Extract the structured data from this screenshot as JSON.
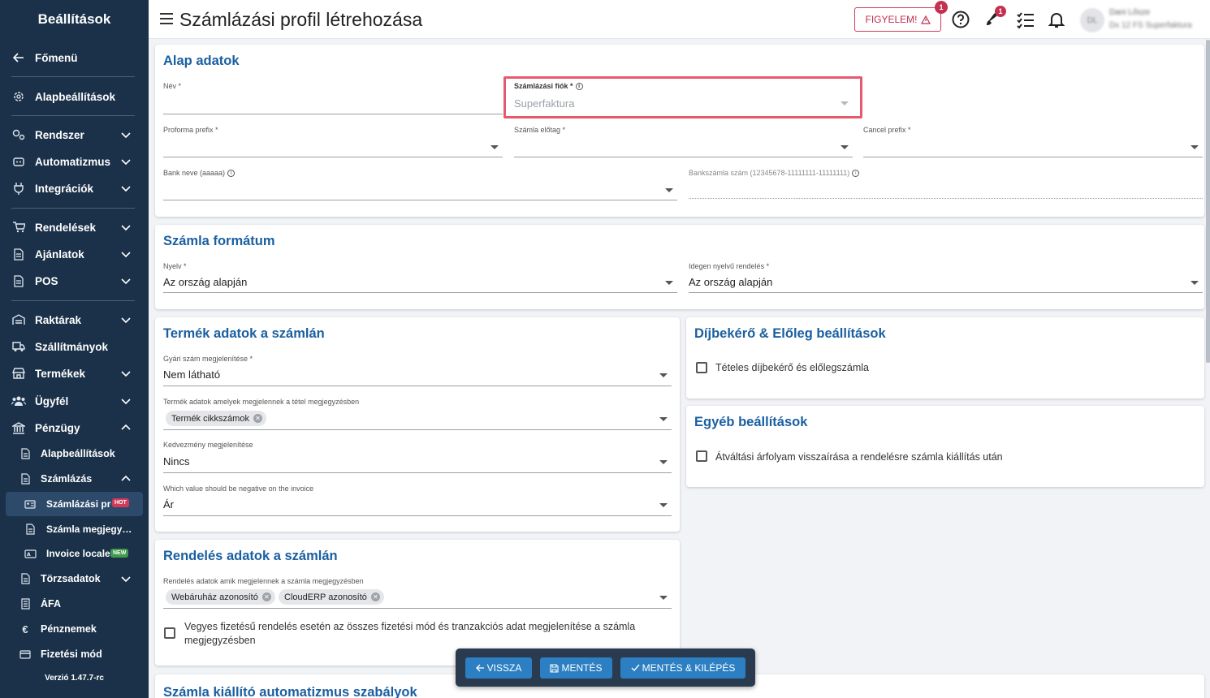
{
  "sidebar": {
    "title": "Beállítások",
    "items": {
      "home": "Főmenü",
      "basic": "Alapbeállítások",
      "system": "Rendszer",
      "automation": "Automatizmus",
      "integrations": "Integrációk",
      "orders": "Rendelések",
      "offers": "Ajánlatok",
      "pos": "POS",
      "warehouses": "Raktárak",
      "shipping": "Szállítmányok",
      "products": "Termékek",
      "customer": "Ügyfél",
      "finance": "Pénzügy",
      "finance_basic": "Alapbeállítások",
      "invoicing": "Számlázás",
      "invoice_profiles": "Számlázási profilok",
      "invoice_notes": "Számla megjegyzések",
      "invoice_locales": "Invoice locales",
      "master_data": "Törzsadatok",
      "vat": "ÁFA",
      "currencies": "Pénznemek",
      "payment_method": "Fizetési mód"
    },
    "badges": {
      "hot": "HOT",
      "new": "NEW"
    },
    "version": "Verzió 1.47.7-rc"
  },
  "header": {
    "title": "Számlázási profil létrehozása",
    "warning_label": "FIGYELEM!",
    "warning_count": "1",
    "rocket_count": "1",
    "avatar_initials": "DL",
    "user_name": "Dani Lősze",
    "user_sub": "Dx 12 FS Superfaktura"
  },
  "basic_data": {
    "title": "Alap adatok",
    "name_label": "Név *",
    "account_label": "Számlázási fiók *",
    "account_value": "Superfaktura",
    "proforma_label": "Proforma prefix *",
    "invoice_prefix_label": "Számla előtag *",
    "cancel_prefix_label": "Cancel prefix *",
    "bank_name_label": "Bank neve (aaaaa)",
    "bank_account_label": "Bankszámla szám (12345678-11111111-11111111)"
  },
  "invoice_format": {
    "title": "Számla formátum",
    "language_label": "Nyelv *",
    "language_value": "Az ország alapján",
    "foreign_label": "Idegen nyelvű rendelés *",
    "foreign_value": "Az ország alapján"
  },
  "product_data": {
    "title": "Termék adatok a számlán",
    "serial_label": "Gyári szám megjelenítése *",
    "serial_value": "Nem látható",
    "product_data_label": "Termék adatok amelyek megjelennek a tétel megjegyzésben",
    "chip_sku": "Termék cikkszámok",
    "discount_label": "Kedvezmény megjelenítése",
    "discount_value": "Nincs",
    "negative_label": "Which value should be negative on the invoice",
    "negative_value": "Ár"
  },
  "fee_settings": {
    "title": "Díjbekérő & Előleg beállítások",
    "itemized_label": "Tételes díjbekérő és előlegszámla"
  },
  "other_settings": {
    "title": "Egyéb beállítások",
    "rate_label": "Átváltási árfolyam visszaírása a rendelésre számla kiállítás után"
  },
  "order_data": {
    "title": "Rendelés adatok a számlán",
    "order_data_label": "Rendelés adatok amik megjelennek a számla megjegyzésben",
    "chip_webshop": "Webáruház azonosító",
    "chip_clouderp": "CloudERP azonosító",
    "mixed_label_1": "Vegyes fizetésű rendelés esetén az összes fizetési mód és tranzakciós adat megjelenítése a számla",
    "mixed_label_2": "megjegyzésben"
  },
  "automation_rules": {
    "title": "Számla kiállító automatizmus szabályok"
  },
  "actions": {
    "back": "VISSZA",
    "save": "MENTÉS",
    "save_exit": "MENTÉS & KILÉPÉS"
  },
  "colors": {
    "sidebar": "#1a3149",
    "accent": "#1a5fa0",
    "button": "#2b7fc2",
    "warning": "#c22f4e"
  }
}
